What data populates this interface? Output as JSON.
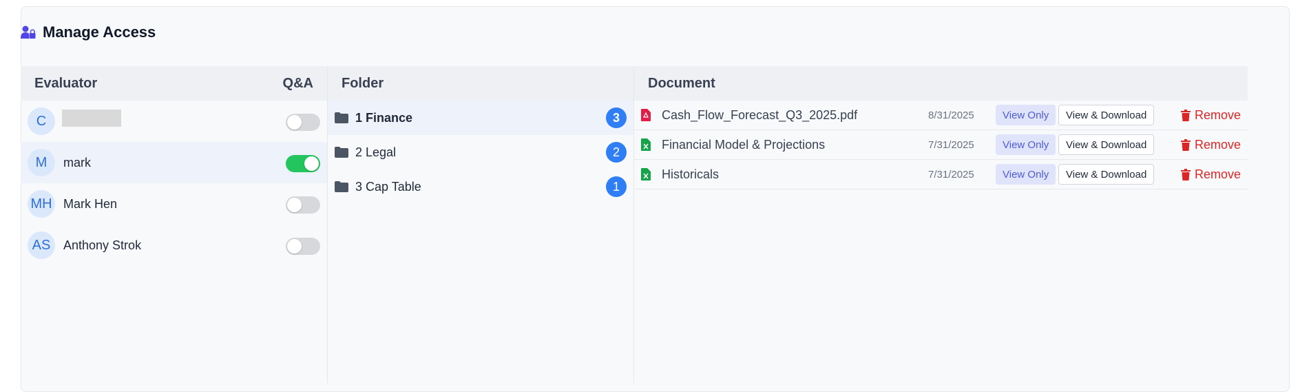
{
  "header": {
    "title": "Manage Access",
    "icon": "user-lock-icon"
  },
  "colors": {
    "accent": "#2f7ef5",
    "toggle_on": "#22c55e",
    "danger": "#dc2626",
    "view_only_bg": "#e0e4fb"
  },
  "evaluators": {
    "column_label": "Evaluator",
    "qa_label": "Q&A",
    "items": [
      {
        "initials": "C",
        "name": "",
        "qa_on": false,
        "selected": false
      },
      {
        "initials": "M",
        "name": "mark",
        "qa_on": true,
        "selected": true
      },
      {
        "initials": "MH",
        "name": "Mark Hen",
        "qa_on": false,
        "selected": false
      },
      {
        "initials": "AS",
        "name": "Anthony Strok",
        "qa_on": false,
        "selected": false
      }
    ]
  },
  "folders": {
    "column_label": "Folder",
    "items": [
      {
        "name": "1 Finance",
        "count": "3",
        "selected": true
      },
      {
        "name": "2 Legal",
        "count": "2",
        "selected": false
      },
      {
        "name": "3 Cap Table",
        "count": "1",
        "selected": false
      }
    ]
  },
  "documents": {
    "column_label": "Document",
    "view_only_label": "View Only",
    "view_download_label": "View & Download",
    "remove_label": "Remove",
    "items": [
      {
        "name": "Cash_Flow_Forecast_Q3_2025.pdf",
        "date": "8/31/2025",
        "icon": "pdf-file-icon"
      },
      {
        "name": "Financial Model & Projections",
        "date": "7/31/2025",
        "icon": "excel-file-icon"
      },
      {
        "name": "Historicals",
        "date": "7/31/2025",
        "icon": "excel-file-icon"
      }
    ]
  }
}
